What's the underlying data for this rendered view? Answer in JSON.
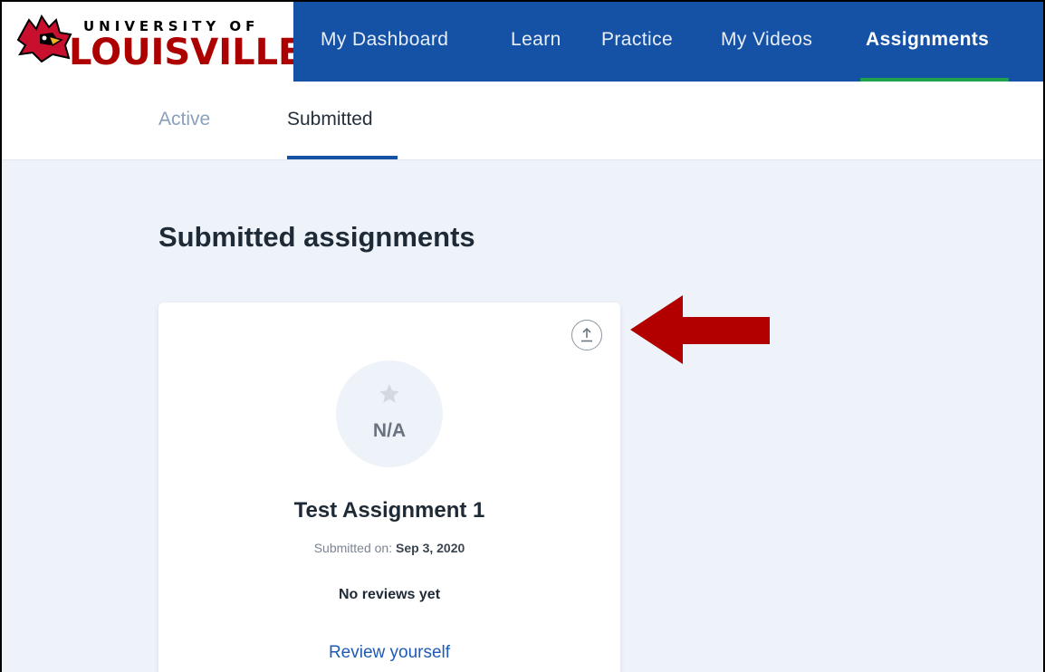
{
  "logo": {
    "top_text": "UNIVERSITY OF",
    "main_text": "LOUISVILLE.",
    "brand_red": "#ad0000"
  },
  "nav": {
    "items": [
      {
        "label": "My Dashboard",
        "active": false
      },
      {
        "label": "Learn",
        "active": false
      },
      {
        "label": "Practice",
        "active": false
      },
      {
        "label": "My Videos",
        "active": false
      },
      {
        "label": "Assignments",
        "active": true
      }
    ],
    "background": "#1552a6",
    "active_underline": "#1ea24a"
  },
  "tabs": [
    {
      "label": "Active",
      "active": false
    },
    {
      "label": "Submitted",
      "active": true
    }
  ],
  "main": {
    "section_title": "Submitted assignments",
    "background": "#eef3fa"
  },
  "card": {
    "upload_icon": "upload-icon",
    "score_icon": "star-icon",
    "score": "N/A",
    "title": "Test Assignment 1",
    "submitted_label": "Submitted on:",
    "submitted_date": "Sep 3, 2020",
    "reviews_text": "No reviews yet",
    "review_link": "Review yourself"
  },
  "annotation": {
    "arrow_color": "#b20000",
    "arrow_icon": "arrow-left-icon"
  }
}
